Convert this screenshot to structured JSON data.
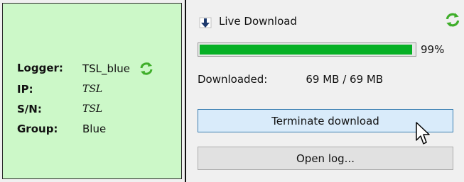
{
  "logger": {
    "labels": {
      "logger": "Logger:",
      "ip": "IP:",
      "sn": "S/N:",
      "group": "Group:"
    },
    "values": {
      "logger": "TSL_blue",
      "ip": "TSL",
      "sn": "TSL",
      "group": "Blue"
    },
    "sync_icon": "sync-icon"
  },
  "download": {
    "title": "Live Download",
    "title_icon": "download-arrow-icon",
    "progress": 0.99,
    "progress_text": "99%",
    "downloaded_label": "Downloaded:",
    "downloaded_value": "69 MB / 69 MB",
    "terminate_label": "Terminate download",
    "open_log_label": "Open log..."
  },
  "colors": {
    "left_panel_bg": "#ccf8c8",
    "progress_fill": "#06b025",
    "button_hover_bg": "#d9ebfa",
    "button_hover_border": "#3c7fb1"
  }
}
